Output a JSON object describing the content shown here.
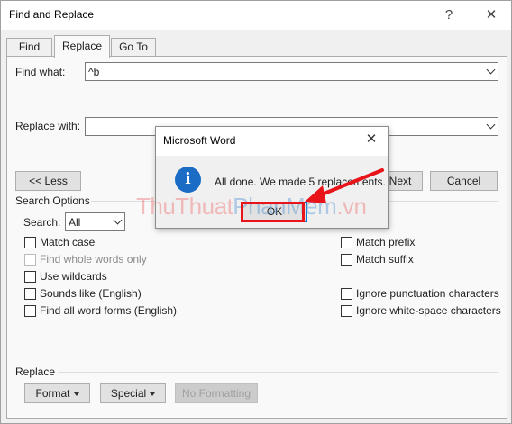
{
  "window": {
    "title": "Find and Replace",
    "help": "?",
    "close": "✕"
  },
  "tabs": [
    {
      "label": "Find"
    },
    {
      "label": "Replace"
    },
    {
      "label": "Go To"
    }
  ],
  "find": {
    "label": "Find what:",
    "value": "^b"
  },
  "replace": {
    "label": "Replace with:",
    "value": ""
  },
  "buttons": {
    "less": "<< Less",
    "next": "Next",
    "cancel": "Cancel"
  },
  "search_options": {
    "heading": "Search Options",
    "search_label": "Search:",
    "search_value": "All",
    "left": [
      {
        "label": "Match case",
        "checked": false,
        "enabled": true
      },
      {
        "label": "Find whole words only",
        "checked": false,
        "enabled": false
      },
      {
        "label": "Use wildcards",
        "checked": false,
        "enabled": true
      },
      {
        "label": "Sounds like (English)",
        "checked": false,
        "enabled": true
      },
      {
        "label": "Find all word forms (English)",
        "checked": false,
        "enabled": true
      }
    ],
    "right": [
      {
        "label": "Match prefix",
        "checked": false
      },
      {
        "label": "Match suffix",
        "checked": false
      },
      {
        "label": "Ignore punctuation characters",
        "checked": false
      },
      {
        "label": "Ignore white-space characters",
        "checked": false
      }
    ]
  },
  "replace_section": {
    "heading": "Replace",
    "format": "Format",
    "special": "Special",
    "no_formatting": "No Formatting"
  },
  "message_box": {
    "title": "Microsoft Word",
    "close": "✕",
    "icon": "information-icon",
    "icon_glyph": "i",
    "message": "All done. We made 5 replacements.",
    "ok": "OK"
  },
  "annotation": {
    "color": "#e8141a"
  },
  "watermark": {
    "part1": "ThuThuat",
    "part2": "PhanMem",
    "part3": ".vn"
  }
}
